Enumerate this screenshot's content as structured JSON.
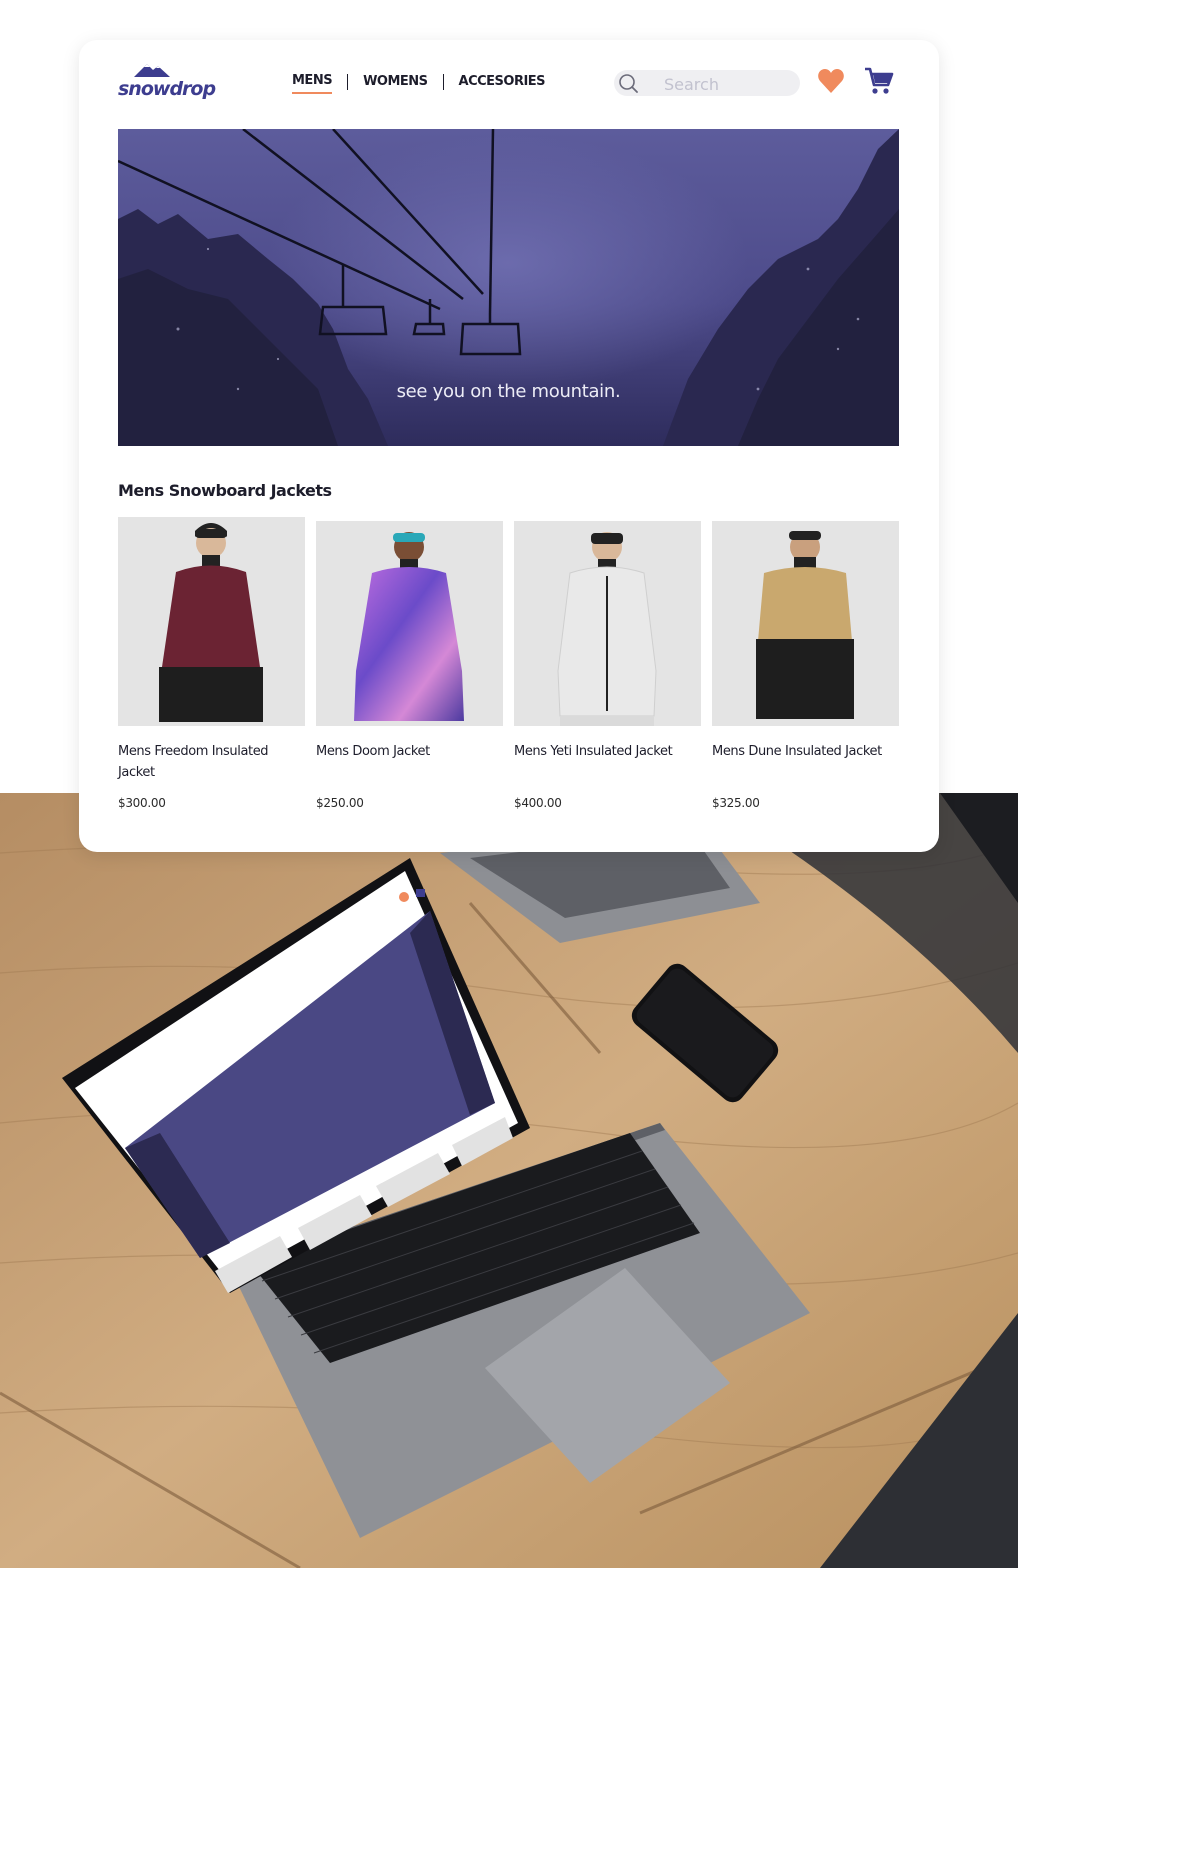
{
  "brand": {
    "name": "snowdrop"
  },
  "nav": {
    "items": [
      {
        "label": "MENS"
      },
      {
        "label": "WOMENS"
      },
      {
        "label": "ACCESORIES"
      }
    ]
  },
  "search": {
    "placeholder": "Search"
  },
  "hero": {
    "tagline": "see you on the mountain."
  },
  "section": {
    "title": "Mens Snowboard Jackets"
  },
  "products": [
    {
      "name": "Mens Freedom Insulated Jacket",
      "price": "$300.00",
      "jacket_color": "#6b2333"
    },
    {
      "name": "Mens Doom Jacket",
      "price": "$250.00",
      "jacket_color": "#8a4fc9"
    },
    {
      "name": "Mens Yeti Insulated Jacket",
      "price": "$400.00",
      "jacket_color": "#dcdcdc"
    },
    {
      "name": "Mens Dune Insulated Jacket",
      "price": "$325.00",
      "jacket_color": "#c9a86e"
    }
  ],
  "mockup": {
    "nav_items": [
      "MENS",
      "WOMENS",
      "ACCESORIES"
    ],
    "search_placeholder": "Search",
    "tagline": "see you on the mountain.",
    "section_title": "Mens Snowboard Jackets",
    "brand": "snowdrop"
  },
  "colors": {
    "accent": "#f08a5d",
    "brand": "#3d3d8f",
    "hero": "#47477f",
    "product_bg": "#e4e4e4",
    "desk": "#c9a57a"
  }
}
